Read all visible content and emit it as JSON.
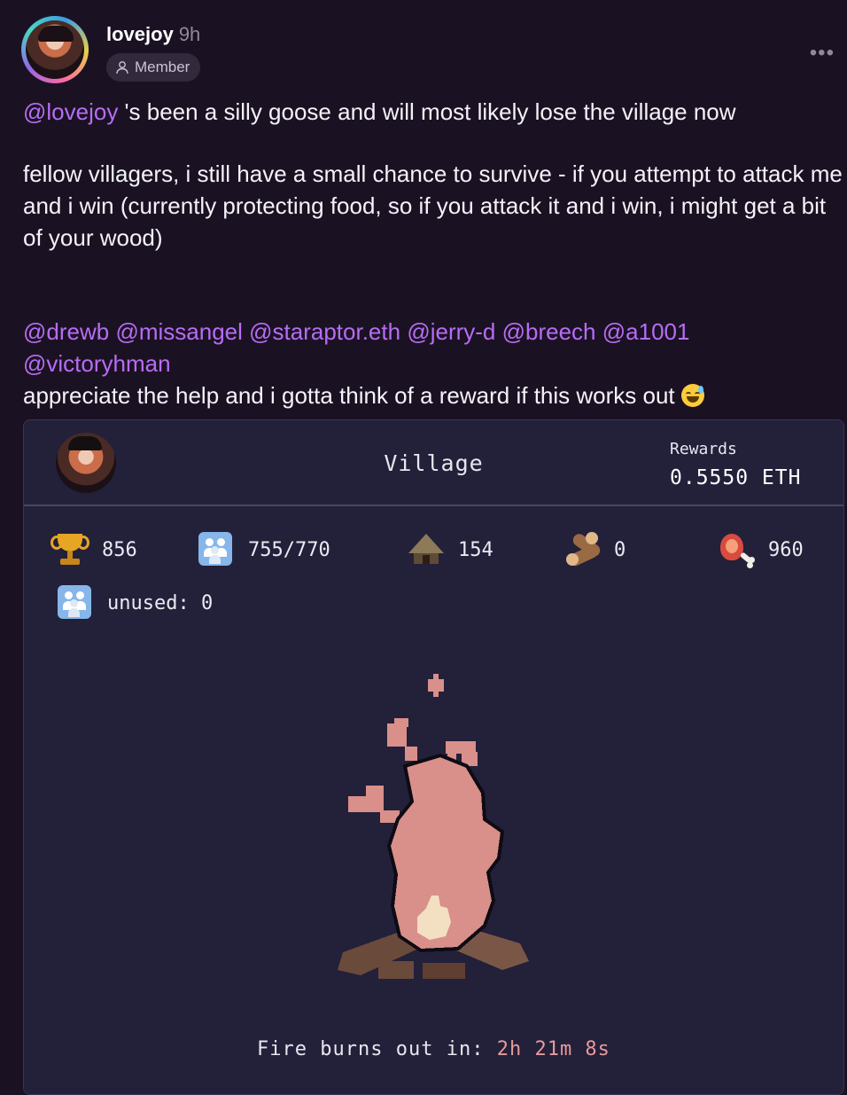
{
  "post": {
    "username": "lovejoy",
    "time_ago": "9h",
    "badge": "Member",
    "more_menu": "•••"
  },
  "body": {
    "line1_mention": "@lovejoy",
    "line1_text": " 's been a silly goose and will most likely lose the village now",
    "para2": "fellow villagers, i still have a small chance to survive - if you attempt to attack me and i win (currently protecting food, so if you attack it and i win, i might get a bit of your wood)",
    "mentions": [
      "@drewb",
      "@missangel",
      "@staraptor.eth",
      "@jerry-d",
      "@breech",
      "@a1001",
      "@victoryhman"
    ],
    "closing": "appreciate the help and i gotta think of a reward if this works out"
  },
  "game": {
    "title": "Village",
    "rewards_label": "Rewards",
    "rewards_value": "0.5550 ETH",
    "stats": {
      "trophies": "856",
      "villagers": "755/770",
      "huts": "154",
      "wood": "0",
      "food": "960",
      "unused": "unused: 0"
    },
    "timer_label": "Fire burns out in: ",
    "timer_value": "2h 21m 8s"
  },
  "icons": [
    "user-icon",
    "more-icon",
    "trophy-icon",
    "villagers-icon",
    "hut-icon",
    "wood-log-icon",
    "meat-icon",
    "campfire-icon",
    "grin-sweat-emoji-icon"
  ],
  "colors": {
    "background": "#1a1223",
    "mention": "#b86cf4",
    "card": "#23203a",
    "fire": "#d98f8a",
    "timer_value": "#e69a9a"
  }
}
